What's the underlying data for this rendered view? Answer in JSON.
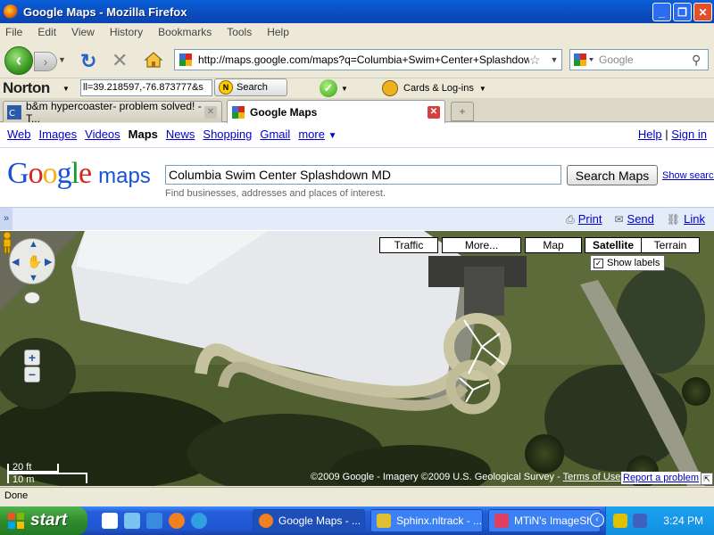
{
  "window": {
    "title": "Google Maps - Mozilla Firefox",
    "buttons": {
      "minimize": "_",
      "maximize": "❐",
      "close": "✕"
    }
  },
  "menubar": [
    "File",
    "Edit",
    "View",
    "History",
    "Bookmarks",
    "Tools",
    "Help"
  ],
  "navbar": {
    "url": "http://maps.google.com/maps?q=Columbia+Swim+Center+Splashdown+MD",
    "search_placeholder": "Google"
  },
  "norton": {
    "logo": "Norton",
    "input_value": "ll=39.218597,-76.873777&s",
    "search_label": "Search",
    "cards_label": "Cards & Log-ins"
  },
  "tabs": [
    {
      "label": "b&m hypercoaster- problem solved! - T...",
      "active": false
    },
    {
      "label": "Google Maps",
      "active": true
    }
  ],
  "google_bar": {
    "links": [
      "Web",
      "Images",
      "Videos",
      "Maps",
      "News",
      "Shopping",
      "Gmail",
      "more"
    ],
    "current": "Maps",
    "help": "Help",
    "sign_in": "Sign in"
  },
  "maps_header": {
    "logo_text": "Google",
    "logo_suffix": "maps",
    "query": "Columbia Swim Center Splashdown MD",
    "search_button": "Search Maps",
    "show_search": "Show search options",
    "hint": "Find businesses, addresses and places of interest."
  },
  "actions": {
    "print": "Print",
    "send": "Send",
    "link": "Link"
  },
  "map": {
    "types": [
      "Traffic",
      "More...",
      "Map",
      "Satellite",
      "Terrain"
    ],
    "selected_type": "Satellite",
    "show_labels": "Show labels",
    "scale_ft": "20 ft",
    "scale_m": "10 m",
    "copyright": "©2009 Google - Imagery ©2009 U.S. Geological Survey - ",
    "terms": "Terms of Use",
    "report": "Report a problem"
  },
  "status": "Done",
  "taskbar": {
    "start": "start",
    "items": [
      {
        "label": "Google Maps - ...",
        "active": true
      },
      {
        "label": "Sphinx.nltrack - ...",
        "active": false
      },
      {
        "label": "MTiN's ImageSh...",
        "active": false
      }
    ],
    "clock": "3:24 PM"
  }
}
